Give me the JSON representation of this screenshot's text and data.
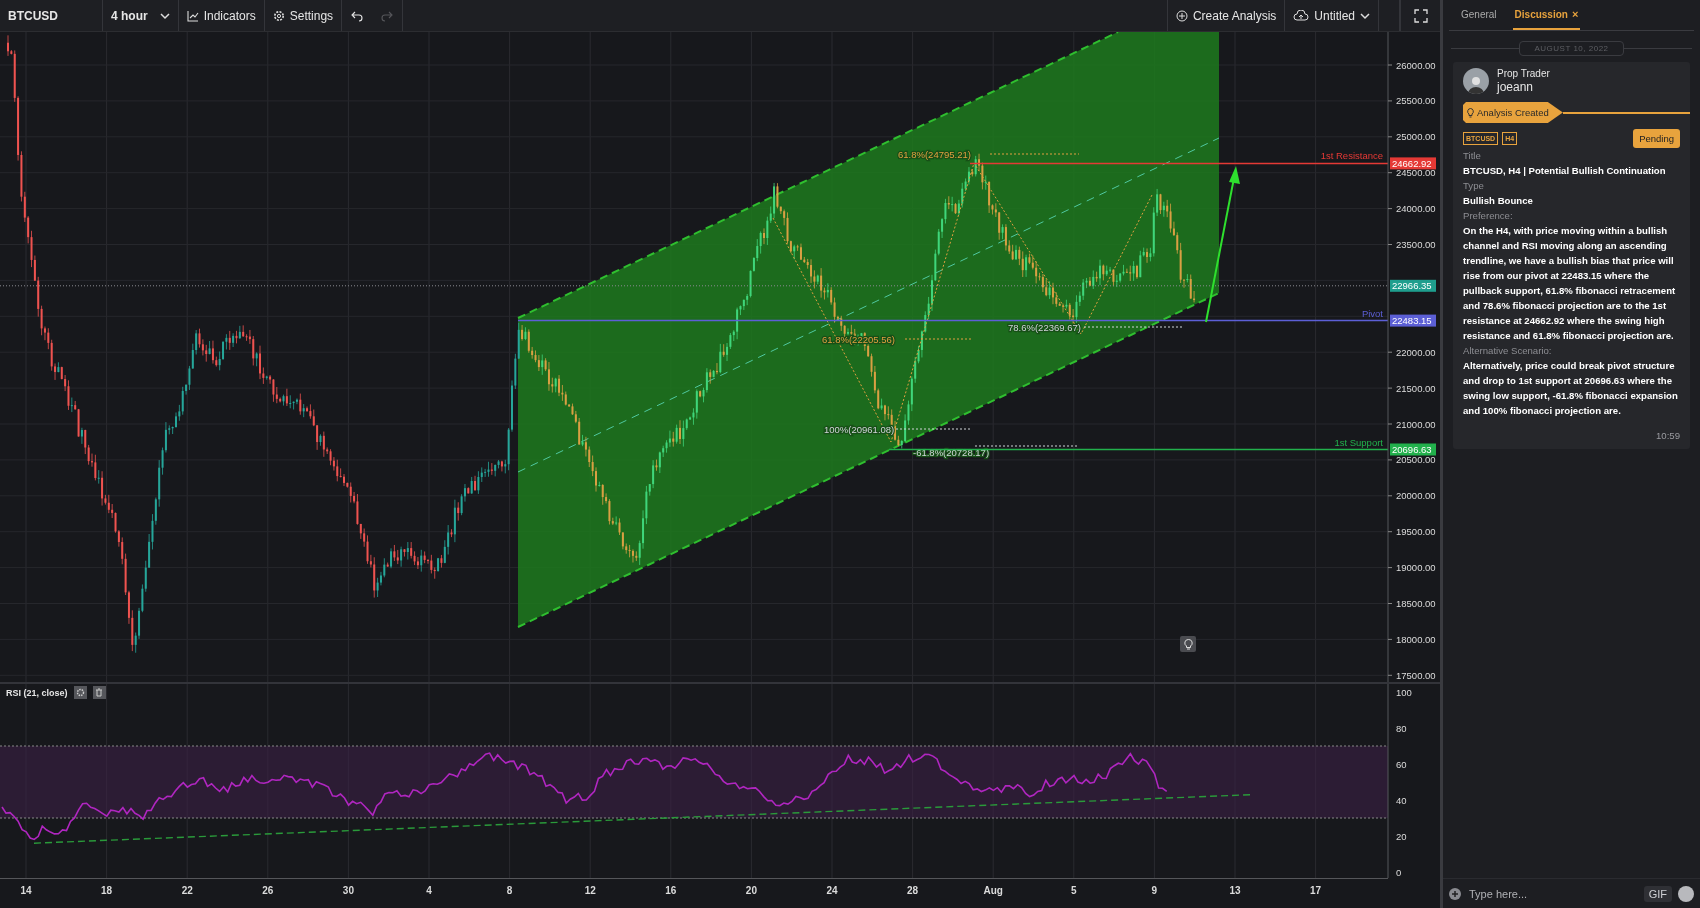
{
  "toolbar": {
    "symbol": "BTCUSD",
    "interval": "4 hour",
    "indicators": "Indicators",
    "settings": "Settings",
    "undo": {
      "disabled": false
    },
    "redo": {
      "disabled": true
    },
    "create_analysis": "Create Analysis",
    "layout": "Untitled"
  },
  "main_chart": {
    "price_ticks": [
      "26000.00",
      "25500.00",
      "25000.00",
      "24500.00",
      "24000.00",
      "23500.00",
      "22000.00",
      "21500.00",
      "21000.00",
      "20500.00",
      "20000.00",
      "19500.00",
      "19000.00",
      "18500.00",
      "18000.00",
      "17500.00"
    ],
    "levels": [
      {
        "label": "1st Resistance",
        "price": "24662.92",
        "color": "#e53935"
      },
      {
        "label": "Pivot",
        "price": "22483.15",
        "color": "#5c5fd6"
      },
      {
        "label": "1st Support",
        "price": "20696.63",
        "color": "#22b14c"
      }
    ],
    "last_price": "22966.35",
    "fib_labels": [
      {
        "text": "61.8%(24795.21)",
        "kind": "primary"
      },
      {
        "text": "61.8%(22205.56)",
        "kind": "primary"
      },
      {
        "text": "78.6%(22369.67)",
        "kind": "secondary"
      },
      {
        "text": "100%(20961.08)",
        "kind": "secondary"
      },
      {
        "text": "-61.8%(20728.17)",
        "kind": "secondary"
      }
    ]
  },
  "rsi": {
    "title": "RSI (21, close)",
    "ticks": [
      "100",
      "80",
      "60",
      "40",
      "20",
      "0"
    ]
  },
  "date_ticks": [
    "14",
    "18",
    "22",
    "26",
    "30",
    "4",
    "8",
    "12",
    "16",
    "20",
    "24",
    "28",
    "Aug",
    "5",
    "9",
    "13",
    "17"
  ],
  "panel": {
    "tabs": [
      {
        "label": "General",
        "selected": false
      },
      {
        "label": "Discussion",
        "selected": true,
        "close": "×"
      }
    ],
    "date": "AUGUST 10, 2022",
    "post": {
      "role": "Prop Trader",
      "author": "joeann",
      "event": "Analysis Created",
      "tags": [
        "BTCUSD",
        "H4"
      ],
      "status": "Pending",
      "fields": [
        {
          "label": "Title",
          "value": "BTCUSD, H4 | Potential Bullish Continuation"
        },
        {
          "label": "Type",
          "value": "Bullish Bounce"
        },
        {
          "label": "Preference:",
          "value": "On the H4, with price moving within a **bullish channel** and RSI moving along an **ascending trendline,** we have a bullish bias that price will rise from our **pivot at 22483.15** where the **pullback support, 61.8% fibonacci retracement** and **78.6% fibonacci projection** are to the **1st resistance at 24662.92** where the **swing high resistance** and **61.8% fibonacci projection** are."
        },
        {
          "label": "Alternative Scenario:",
          "value": "Alternatively, price could break pivot structure and drop to **1st support at 20696.63** where the **swing low support, -61.8% fibonacci expansion** and **100% fibonacci projection** are."
        }
      ],
      "time": "10:59"
    },
    "composer": {
      "placeholder": "Type here...",
      "gif": "GIF"
    }
  }
}
